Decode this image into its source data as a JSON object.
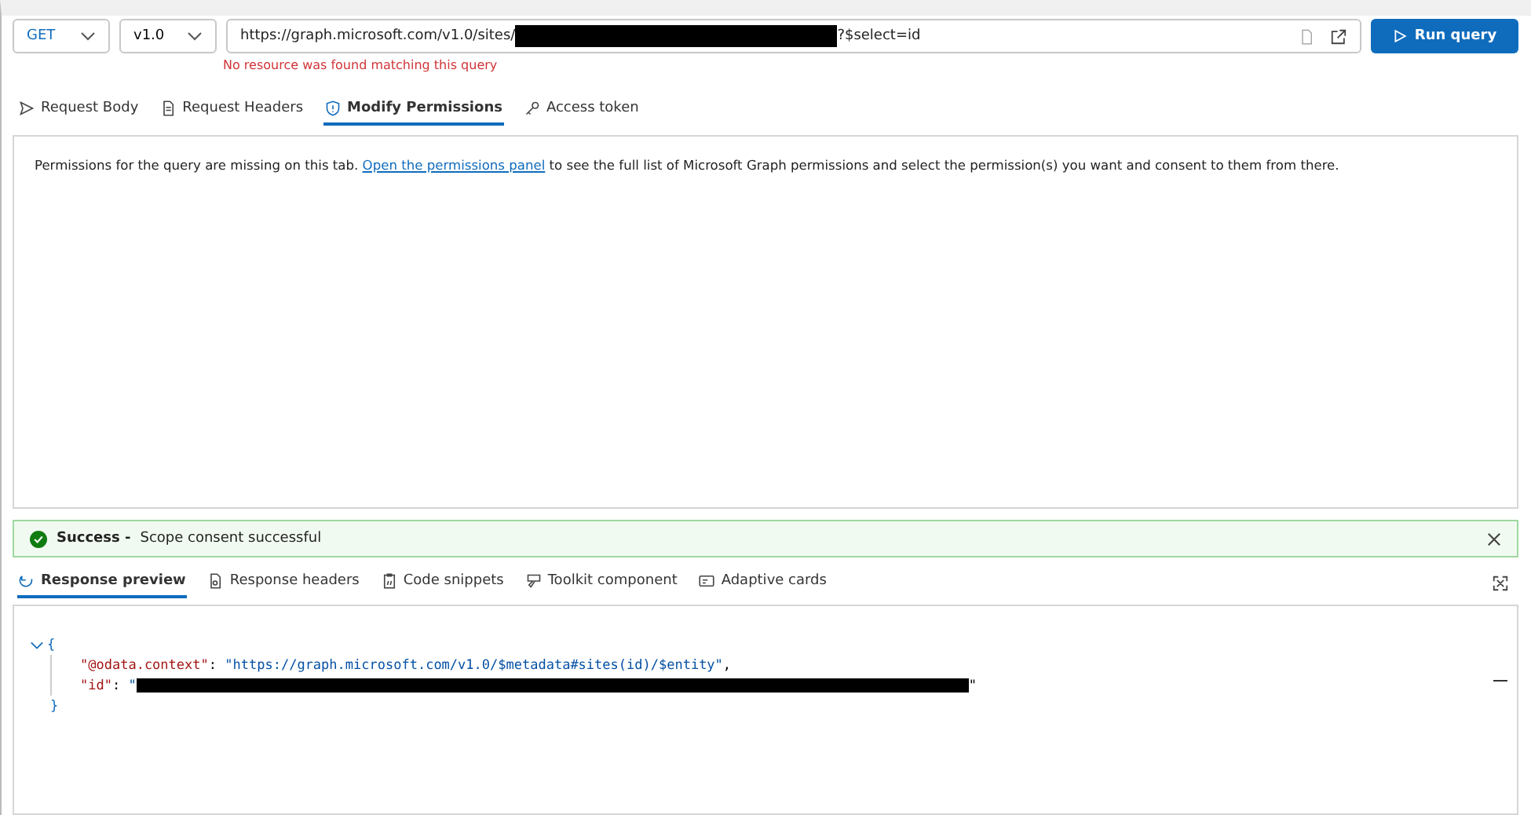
{
  "method": {
    "label": "GET"
  },
  "version": {
    "label": "v1.0"
  },
  "url": {
    "prefix": "https://graph.microsoft.com/v1.0/sites/",
    "suffix": "?$select=id",
    "redacted": true
  },
  "url_error": "No resource was found matching this query",
  "run_button": "Run query",
  "request_tabs": [
    {
      "label": "Request Body",
      "selected": false
    },
    {
      "label": "Request Headers",
      "selected": false
    },
    {
      "label": "Modify Permissions",
      "selected": true
    },
    {
      "label": "Access token",
      "selected": false
    }
  ],
  "permissions_message": {
    "before": "Permissions for the query are missing on this tab.",
    "link": "Open the permissions panel",
    "after": "to see the full list of Microsoft Graph permissions and select the permission(s) you want and consent to them from there."
  },
  "banner": {
    "title": "Success -",
    "message": "Scope consent successful"
  },
  "response_tabs": [
    {
      "label": "Response preview",
      "selected": true
    },
    {
      "label": "Response headers",
      "selected": false
    },
    {
      "label": "Code snippets",
      "selected": false
    },
    {
      "label": "Toolkit component",
      "selected": false
    },
    {
      "label": "Adaptive cards",
      "selected": false
    }
  ],
  "response": {
    "open_brace": "{",
    "close_brace": "}",
    "expanded": true,
    "lines": [
      {
        "key": "\"@odata.context\"",
        "colon": ":",
        "value": "\"https://graph.microsoft.com/v1.0/$metadata#sites(id)/$entity\"",
        "trail": ",",
        "redacted": false
      },
      {
        "key": "\"id\"",
        "colon": ":",
        "value": "\"",
        "trail": "\"",
        "redacted": true
      }
    ]
  }
}
